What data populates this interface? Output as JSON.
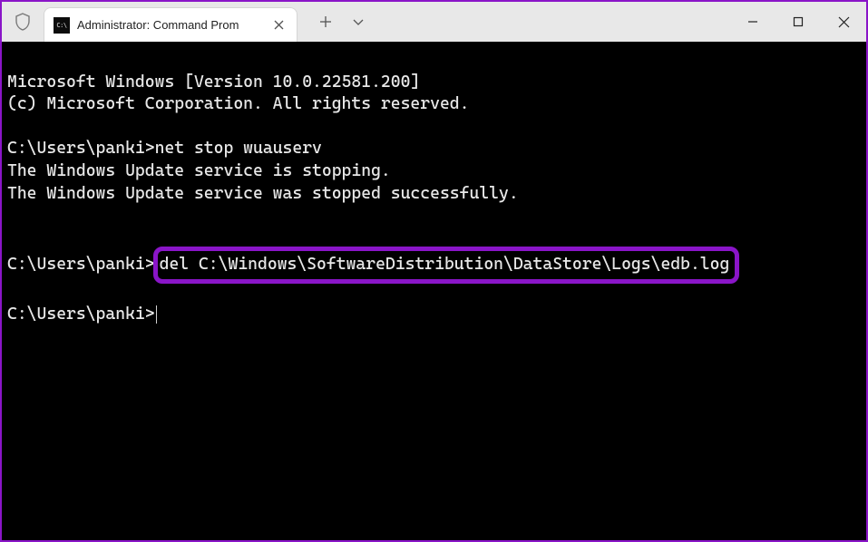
{
  "window": {
    "tab_title": "Administrator: Command Prom",
    "icons": {
      "shield": "shield-icon",
      "tab_app": "cmd-icon",
      "tab_close": "close-icon",
      "new_tab": "plus-icon",
      "dropdown": "chevron-down-icon",
      "minimize": "minimize-icon",
      "maximize": "maximize-icon",
      "window_close": "close-icon"
    }
  },
  "terminal": {
    "lines": {
      "l0": "Microsoft Windows [Version 10.0.22581.200]",
      "l1": "(c) Microsoft Corporation. All rights reserved.",
      "l2": "",
      "l3_prompt": "C:\\Users\\panki>",
      "l3_cmd": "net stop wuauserv",
      "l4": "The Windows Update service is stopping.",
      "l5": "The Windows Update service was stopped successfully.",
      "l6": "",
      "l7": "",
      "l8_prompt": "C:\\Users\\panki>",
      "l8_cmd": "del C:\\Windows\\SoftwareDistribution\\DataStore\\Logs\\edb.log",
      "l9": "",
      "l10_prompt": "C:\\Users\\panki>"
    }
  },
  "colors": {
    "accent": "#8a15c8",
    "terminal_bg": "#000000",
    "terminal_fg": "#e8e8e8",
    "titlebar_bg": "#e8e8e8",
    "tab_bg": "#ffffff"
  }
}
